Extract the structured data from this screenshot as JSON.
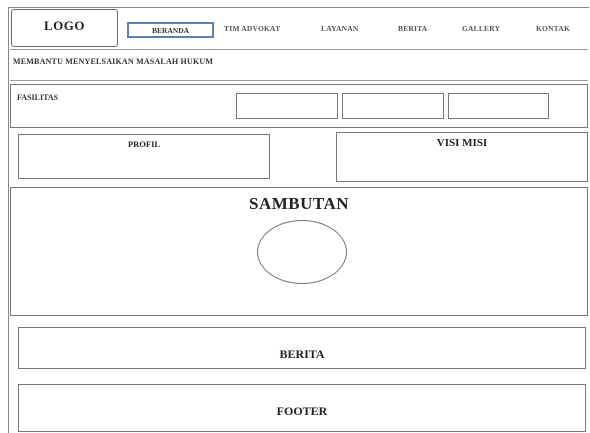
{
  "header": {
    "logo": "LOGO",
    "nav": [
      "BERANDA",
      "TIM ADVOKAT",
      "LAYANAN",
      "BERITA",
      "GALLERY",
      "KONTAK"
    ],
    "active_nav": "BERANDA"
  },
  "tagline": "MEMBANTU MENYELSAIKAN MASALAH HUKUM",
  "fasilitas": {
    "label": "FASILITAS"
  },
  "profil": {
    "label": "PROFIL"
  },
  "visi_misi": {
    "label": "VISI MISI"
  },
  "sambutan": {
    "label": "SAMBUTAN"
  },
  "berita": {
    "label": "BERITA"
  },
  "footer": {
    "label": "FOOTER"
  },
  "colors": {
    "active_border": "#5b7fb3",
    "line": "#777777"
  }
}
